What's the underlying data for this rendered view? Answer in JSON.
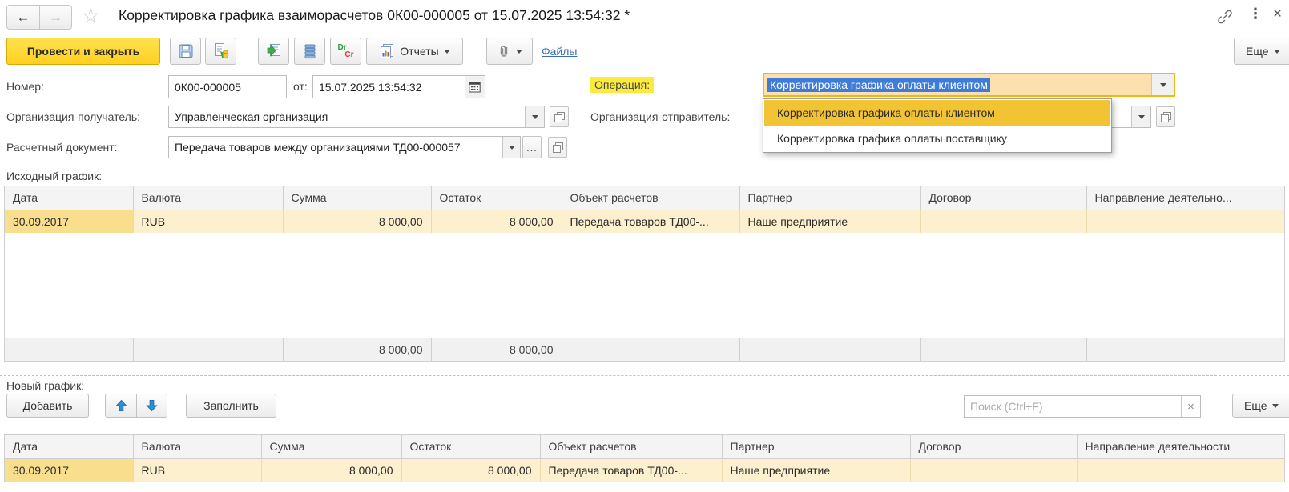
{
  "window": {
    "title": "Корректировка графика взаиморасчетов 0К00-000005 от 15.07.2025 13:54:32 *",
    "icons": {
      "back": "←",
      "forward": "→",
      "star": "☆",
      "kebab": "⋮",
      "close": "×"
    }
  },
  "toolbar": {
    "post_and_close": "Провести и закрыть",
    "reports": "Отчеты",
    "files_link": "Файлы",
    "more": "Еще",
    "drcr": {
      "dr": "Dr",
      "cr": "Cr"
    }
  },
  "form": {
    "number_label": "Номер:",
    "number_value": "0К00-000005",
    "date_label": "от:",
    "date_value": "15.07.2025 13:54:32",
    "operation_label": "Операция:",
    "operation_value": "Корректировка графика оплаты клиентом",
    "operation_options": [
      "Корректировка графика оплаты клиентом",
      "Корректировка графика оплаты поставщику"
    ],
    "org_receiver_label": "Организация-получатель:",
    "org_receiver_value": "Управленческая организация",
    "org_sender_label": "Организация-отправитель:",
    "settlement_doc_label": "Расчетный документ:",
    "settlement_doc_value": "Передача товаров между организациями ТД00-000057",
    "ellipsis": "..."
  },
  "source_schedule": {
    "section_label": "Исходный график:",
    "columns": [
      "Дата",
      "Валюта",
      "Сумма",
      "Остаток",
      "Объект расчетов",
      "Партнер",
      "Договор",
      "Направление деятельно..."
    ],
    "row": {
      "date": "30.09.2017",
      "currency": "RUB",
      "amount": "8 000,00",
      "remainder": "8 000,00",
      "settlement_object": "Передача товаров ТД00-...",
      "partner": "Наше предприятие",
      "contract": "",
      "business_direction": ""
    },
    "totals": {
      "amount": "8 000,00",
      "remainder": "8 000,00"
    }
  },
  "new_schedule": {
    "section_label": "Новый график:",
    "add_button": "Добавить",
    "fill_button": "Заполнить",
    "search_placeholder": "Поиск (Ctrl+F)",
    "clear_search": "×",
    "more_button": "Еще",
    "columns": [
      "Дата",
      "Валюта",
      "Сумма",
      "Остаток",
      "Объект расчетов",
      "Партнер",
      "Договор",
      "Направление деятельности"
    ],
    "row": {
      "date": "30.09.2017",
      "currency": "RUB",
      "amount": "8 000,00",
      "remainder": "8 000,00",
      "settlement_object": "Передача товаров ТД00-...",
      "partner": "Наше предприятие",
      "contract": "",
      "business_direction": ""
    }
  }
}
